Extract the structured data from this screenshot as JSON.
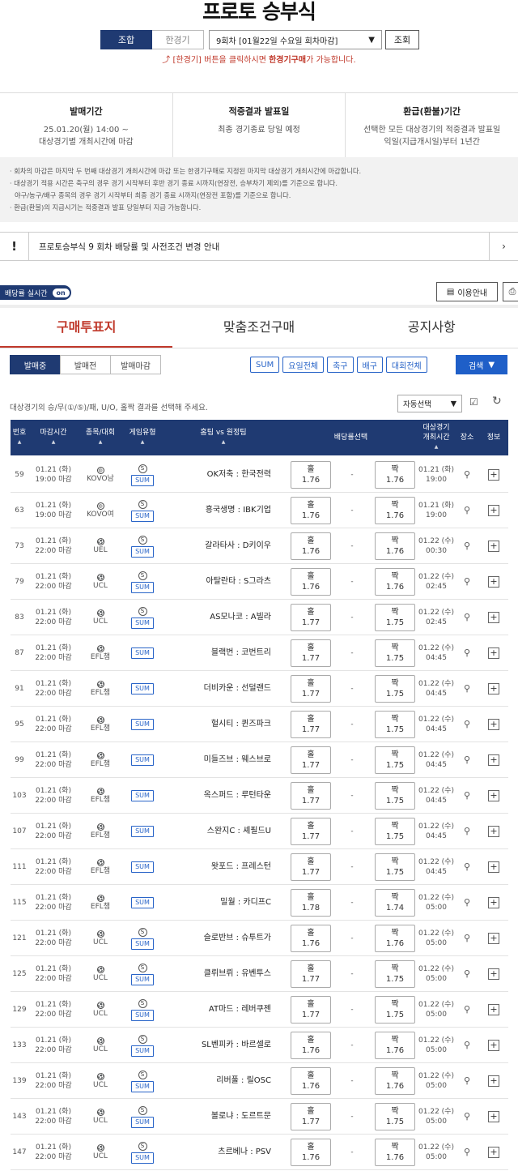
{
  "header": {
    "title": "프로토 승부식",
    "combo_label": "조합",
    "single_label": "한경기",
    "round_select": "9회차 [01월22일 수요일 회차마감]",
    "look_label": "조회",
    "notice_pre": "⤴ [한경기] 버튼을 클릭하시면 ",
    "notice_bold": "한경기구매",
    "notice_post": "가 가능합니다."
  },
  "info": [
    {
      "head": "발매기간",
      "line1": "25.01.20(월) 14:00 ~",
      "line2": "대상경기별 개최시간에 마감"
    },
    {
      "head": "적중결과 발표일",
      "line1": "최종 경기종료 당일 예정",
      "line2": ""
    },
    {
      "head": "환급(환불)기간",
      "line1": "선택한 모든 대상경기의 적중결과 발표일",
      "line2": "익일(지급개시일)부터 1년간"
    }
  ],
  "rules": [
    "· 회차의 마감은 마지막 두 번째 대상경기 개최시간에 마감 또는 한경기구매로 지정된 마지막 대상경기 개최시간에 마감합니다.",
    "· 대상경기 적용 시간은 축구의 경우 경기 시작부터 후반 경기 종료 시까지(연장전, 승부차기 제외)를 기준으로 합니다.",
    "  야구/농구/배구 종목의 경우 경기 시작부터 최종 경기 종료 시까지(연장전 포함)를 기준으로 합니다.",
    "· 환급(환불)의 지급시기는 적중결과 발표 당일부터 지급 가능합니다."
  ],
  "announce": {
    "mark": "!",
    "text": "프로토승부식 9 회차 배당률 및 사전조건 변경 안내",
    "chev": "›"
  },
  "realtime": {
    "label": "배당률 실시간",
    "toggle": "on"
  },
  "guide_label": "이용안내",
  "tabs": [
    "구매투표지",
    "맞춤조건구매",
    "공지사항"
  ],
  "segments": [
    "발매중",
    "발매전",
    "발매마감"
  ],
  "filters": [
    "SUM",
    "요일전체",
    "축구",
    "배구",
    "대회전체"
  ],
  "search_label": "검색",
  "hint": "대상경기의 승/무(①/⑤)/패, U/O, 홀짝 결과를 선택해 주세요.",
  "auto_select": "자동선택",
  "columns": {
    "no": "번호",
    "deadline": "마감시간",
    "league": "종목/대회",
    "gtype": "게임유형",
    "match": "홈팀 vs 원정팀",
    "odds": "배당률선택",
    "start1": "대상경기",
    "start2": "개최시간",
    "place": "장소",
    "info": "정보"
  },
  "rows": [
    {
      "no": "59",
      "date": "01.21 (화)",
      "close": "19:00 마감",
      "sport": "vb",
      "league": "KOVO남",
      "match": "OK저축 : 한국전력",
      "odd_home": "1.76",
      "odd_away": "1.76",
      "sd": "01.21 (화)",
      "st": "19:00"
    },
    {
      "no": "63",
      "date": "01.21 (화)",
      "close": "19:00 마감",
      "sport": "vb",
      "league": "KOVO여",
      "match": "흥국생명 : IBK기업",
      "odd_home": "1.76",
      "odd_away": "1.76",
      "sd": "01.21 (화)",
      "st": "19:00"
    },
    {
      "no": "73",
      "date": "01.21 (화)",
      "close": "22:00 마감",
      "sport": "fb",
      "league": "UEL",
      "match": "갈라타사 : D키이우",
      "odd_home": "1.76",
      "odd_away": "1.76",
      "sd": "01.22 (수)",
      "st": "00:30"
    },
    {
      "no": "79",
      "date": "01.21 (화)",
      "close": "22:00 마감",
      "sport": "fb",
      "league": "UCL",
      "match": "아탈란타 : S그라츠",
      "odd_home": "1.76",
      "odd_away": "1.76",
      "sd": "01.22 (수)",
      "st": "02:45"
    },
    {
      "no": "83",
      "date": "01.21 (화)",
      "close": "22:00 마감",
      "sport": "fb",
      "league": "UCL",
      "match": "AS모나코 : A빌라",
      "odd_home": "1.77",
      "odd_away": "1.75",
      "sd": "01.22 (수)",
      "st": "02:45"
    },
    {
      "no": "87",
      "date": "01.21 (화)",
      "close": "22:00 마감",
      "sport": "fb",
      "league": "EFL챔",
      "match": "블랙번 : 코번트리",
      "odd_home": "1.77",
      "odd_away": "1.75",
      "sd": "01.22 (수)",
      "st": "04:45"
    },
    {
      "no": "91",
      "date": "01.21 (화)",
      "close": "22:00 마감",
      "sport": "fb",
      "league": "EFL챔",
      "match": "더비카운 : 선덜랜드",
      "odd_home": "1.77",
      "odd_away": "1.75",
      "sd": "01.22 (수)",
      "st": "04:45"
    },
    {
      "no": "95",
      "date": "01.21 (화)",
      "close": "22:00 마감",
      "sport": "fb",
      "league": "EFL챔",
      "match": "헐시티 : 퀸즈파크",
      "odd_home": "1.77",
      "odd_away": "1.75",
      "sd": "01.22 (수)",
      "st": "04:45"
    },
    {
      "no": "99",
      "date": "01.21 (화)",
      "close": "22:00 마감",
      "sport": "fb",
      "league": "EFL챔",
      "match": "미들즈브 : 웨스브로",
      "odd_home": "1.77",
      "odd_away": "1.75",
      "sd": "01.22 (수)",
      "st": "04:45"
    },
    {
      "no": "103",
      "date": "01.21 (화)",
      "close": "22:00 마감",
      "sport": "fb",
      "league": "EFL챔",
      "match": "옥스퍼드 : 루턴타운",
      "odd_home": "1.77",
      "odd_away": "1.75",
      "sd": "01.22 (수)",
      "st": "04:45"
    },
    {
      "no": "107",
      "date": "01.21 (화)",
      "close": "22:00 마감",
      "sport": "fb",
      "league": "EFL챔",
      "match": "스완지C : 셰필드U",
      "odd_home": "1.77",
      "odd_away": "1.75",
      "sd": "01.22 (수)",
      "st": "04:45"
    },
    {
      "no": "111",
      "date": "01.21 (화)",
      "close": "22:00 마감",
      "sport": "fb",
      "league": "EFL챔",
      "match": "왓포드 : 프레스턴",
      "odd_home": "1.77",
      "odd_away": "1.75",
      "sd": "01.22 (수)",
      "st": "04:45"
    },
    {
      "no": "115",
      "date": "01.21 (화)",
      "close": "22:00 마감",
      "sport": "fb",
      "league": "EFL챔",
      "match": "밀월 : 카디프C",
      "odd_home": "1.78",
      "odd_away": "1.74",
      "sd": "01.22 (수)",
      "st": "05:00"
    },
    {
      "no": "121",
      "date": "01.21 (화)",
      "close": "22:00 마감",
      "sport": "fb",
      "league": "UCL",
      "match": "슬로반브 : 슈투트가",
      "odd_home": "1.76",
      "odd_away": "1.76",
      "sd": "01.22 (수)",
      "st": "05:00"
    },
    {
      "no": "125",
      "date": "01.21 (화)",
      "close": "22:00 마감",
      "sport": "fb",
      "league": "UCL",
      "match": "클뤼브뤼 : 유벤투스",
      "odd_home": "1.77",
      "odd_away": "1.75",
      "sd": "01.22 (수)",
      "st": "05:00"
    },
    {
      "no": "129",
      "date": "01.21 (화)",
      "close": "22:00 마감",
      "sport": "fb",
      "league": "UCL",
      "match": "AT마드 : 레버쿠젠",
      "odd_home": "1.77",
      "odd_away": "1.75",
      "sd": "01.22 (수)",
      "st": "05:00"
    },
    {
      "no": "133",
      "date": "01.21 (화)",
      "close": "22:00 마감",
      "sport": "fb",
      "league": "UCL",
      "match": "SL벤피카 : 바르셀로",
      "odd_home": "1.76",
      "odd_away": "1.76",
      "sd": "01.22 (수)",
      "st": "05:00"
    },
    {
      "no": "139",
      "date": "01.21 (화)",
      "close": "22:00 마감",
      "sport": "fb",
      "league": "UCL",
      "match": "리버풀 : 릴OSC",
      "odd_home": "1.76",
      "odd_away": "1.76",
      "sd": "01.22 (수)",
      "st": "05:00"
    },
    {
      "no": "143",
      "date": "01.21 (화)",
      "close": "22:00 마감",
      "sport": "fb",
      "league": "UCL",
      "match": "볼로냐 : 도르트문",
      "odd_home": "1.77",
      "odd_away": "1.75",
      "sd": "01.22 (수)",
      "st": "05:00"
    },
    {
      "no": "147",
      "date": "01.21 (화)",
      "close": "22:00 마감",
      "sport": "fb",
      "league": "UCL",
      "match": "츠르베나 : PSV",
      "odd_home": "1.76",
      "odd_away": "1.76",
      "sd": "01.22 (수)",
      "st": "05:00"
    }
  ],
  "odd_labels": {
    "home": "홀",
    "away": "짝",
    "dash": "-",
    "sum": "SUM",
    "s": "S"
  },
  "colors": {
    "navy": "#1f3a72",
    "red": "#c0392b",
    "blue": "#2a65c8"
  }
}
